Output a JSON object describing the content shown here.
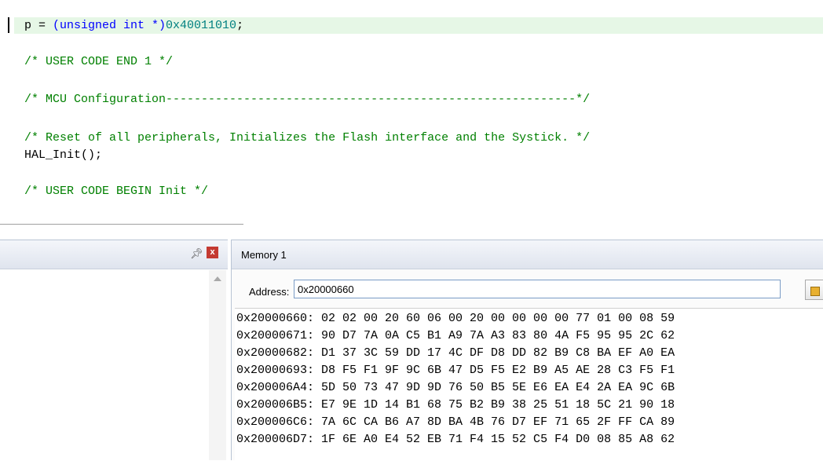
{
  "editor": {
    "lines": [
      {
        "segments": [
          {
            "t": "p = ",
            "c": "pl"
          },
          {
            "t": "(unsigned int *)",
            "c": "kw"
          },
          {
            "t": "0x40011010",
            "c": "num"
          },
          {
            "t": ";",
            "c": "pl"
          }
        ]
      },
      {
        "segments": [
          {
            "t": "/* USER CODE END 1 */",
            "c": "cmt"
          }
        ]
      },
      {
        "segments": [
          {
            "t": "/* MCU Configuration----------------------------------------------------------*/",
            "c": "cmt"
          }
        ]
      },
      {
        "segments": [
          {
            "t": "/* Reset of all peripherals, Initializes the Flash interface and the Systick. */",
            "c": "cmt"
          }
        ]
      },
      {
        "segments": [
          {
            "t": "HAL_Init();",
            "c": "pl"
          }
        ]
      },
      {
        "segments": [
          {
            "t": "/* USER CODE BEGIN Init */",
            "c": "cmt"
          }
        ]
      }
    ]
  },
  "left_panel": {
    "pin_icon": "pin-icon",
    "close_icon": "close-icon",
    "close_label": "x"
  },
  "memory": {
    "title": "Memory 1",
    "address_label": "Address:",
    "address_value": "0x20000660",
    "rows": [
      "0x20000660: 02 02 00 20 60 06 00 20 00 00 00 00 77 01 00 08 59",
      "0x20000671: 90 D7 7A 0A C5 B1 A9 7A A3 83 80 4A F5 95 95 2C 62",
      "0x20000682: D1 37 3C 59 DD 17 4C DF D8 DD 82 B9 C8 BA EF A0 EA",
      "0x20000693: D8 F5 F1 9F 9C 6B 47 D5 F5 E2 B9 A5 AE 28 C3 F5 F1",
      "0x200006A4: 5D 50 73 47 9D 9D 76 50 B5 5E E6 EA E4 2A EA 9C 6B",
      "0x200006B5: E7 9E 1D 14 B1 68 75 B2 B9 38 25 51 18 5C 21 90 18",
      "0x200006C6: 7A 6C CA B6 A7 8D BA 4B 76 D7 EF 71 65 2F FF CA 89",
      "0x200006D7: 1F 6E A0 E4 52 EB 71 F4 15 52 C5 F4 D0 08 85 A8 62"
    ]
  },
  "colors": {
    "comment": "#008000",
    "keyword": "#0000ff",
    "number": "#008080",
    "current_line": "#e6f7e6"
  }
}
